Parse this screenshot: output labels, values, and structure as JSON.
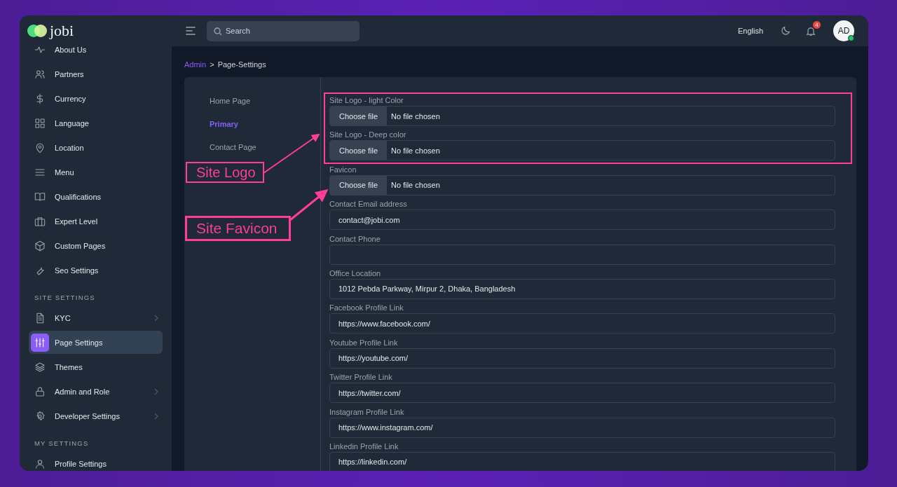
{
  "brand": {
    "name": "jobi"
  },
  "sidebar": {
    "items": [
      {
        "label": "About Us",
        "selected": false,
        "has_submenu": false
      },
      {
        "label": "Partners",
        "selected": false,
        "has_submenu": false
      },
      {
        "label": "Currency",
        "selected": false,
        "has_submenu": false
      },
      {
        "label": "Language",
        "selected": false,
        "has_submenu": false
      },
      {
        "label": "Location",
        "selected": false,
        "has_submenu": false
      },
      {
        "label": "Menu",
        "selected": false,
        "has_submenu": false
      },
      {
        "label": "Qualifications",
        "selected": false,
        "has_submenu": false
      },
      {
        "label": "Expert Level",
        "selected": false,
        "has_submenu": false
      },
      {
        "label": "Custom Pages",
        "selected": false,
        "has_submenu": false
      },
      {
        "label": "Seo Settings",
        "selected": false,
        "has_submenu": false
      }
    ],
    "sections": [
      {
        "heading": "SITE SETTINGS",
        "items": [
          {
            "label": "KYC",
            "selected": false,
            "has_submenu": true
          },
          {
            "label": "Page Settings",
            "selected": true,
            "has_submenu": false
          },
          {
            "label": "Themes",
            "selected": false,
            "has_submenu": false
          },
          {
            "label": "Admin and Role",
            "selected": false,
            "has_submenu": true
          },
          {
            "label": "Developer Settings",
            "selected": false,
            "has_submenu": true
          }
        ]
      },
      {
        "heading": "MY SETTINGS",
        "items": [
          {
            "label": "Profile Settings",
            "selected": false,
            "has_submenu": false
          }
        ]
      }
    ]
  },
  "header": {
    "search": {
      "placeholder": "Search"
    },
    "language": "English",
    "notifications": "4",
    "avatar": "AD",
    "online": true
  },
  "breadcrumb": [
    "Admin",
    ">",
    "Page-Settings"
  ],
  "tabs": [
    {
      "label": "Home Page",
      "selected": false
    },
    {
      "label": "Primary",
      "selected": true
    },
    {
      "label": "Contact Page",
      "selected": false
    }
  ],
  "fields": [
    {
      "kind": "file",
      "label": "Site Logo - light Color",
      "button": "Choose file",
      "status": "No file chosen"
    },
    {
      "kind": "file",
      "label": "Site Logo - Deep color",
      "button": "Choose file",
      "status": "No file chosen"
    },
    {
      "kind": "file",
      "label": "Favicon",
      "button": "Choose file",
      "status": "No file chosen"
    },
    {
      "kind": "text",
      "label": "Contact Email address",
      "value": "contact@jobi.com"
    },
    {
      "kind": "text",
      "label": "Contact Phone"
    },
    {
      "kind": "text",
      "label": "Office Location",
      "value": "1012 Pebda Parkway, Mirpur 2, Dhaka, Bangladesh"
    },
    {
      "kind": "text",
      "label": "Facebook Profile Link",
      "value": "https://www.facebook.com/"
    },
    {
      "kind": "text",
      "label": "Youtube Profile Link",
      "value": "https://youtube.com/"
    },
    {
      "kind": "text",
      "label": "Twitter Profile Link",
      "value": "https://twitter.com/"
    },
    {
      "kind": "text",
      "label": "Instagram Profile Link",
      "value": "https://www.instagram.com/"
    },
    {
      "kind": "text",
      "label": "Linkedin Profile Link",
      "value": "https://linkedin.com/"
    }
  ],
  "annotations": [
    "Site Logo",
    "Site Favicon"
  ]
}
